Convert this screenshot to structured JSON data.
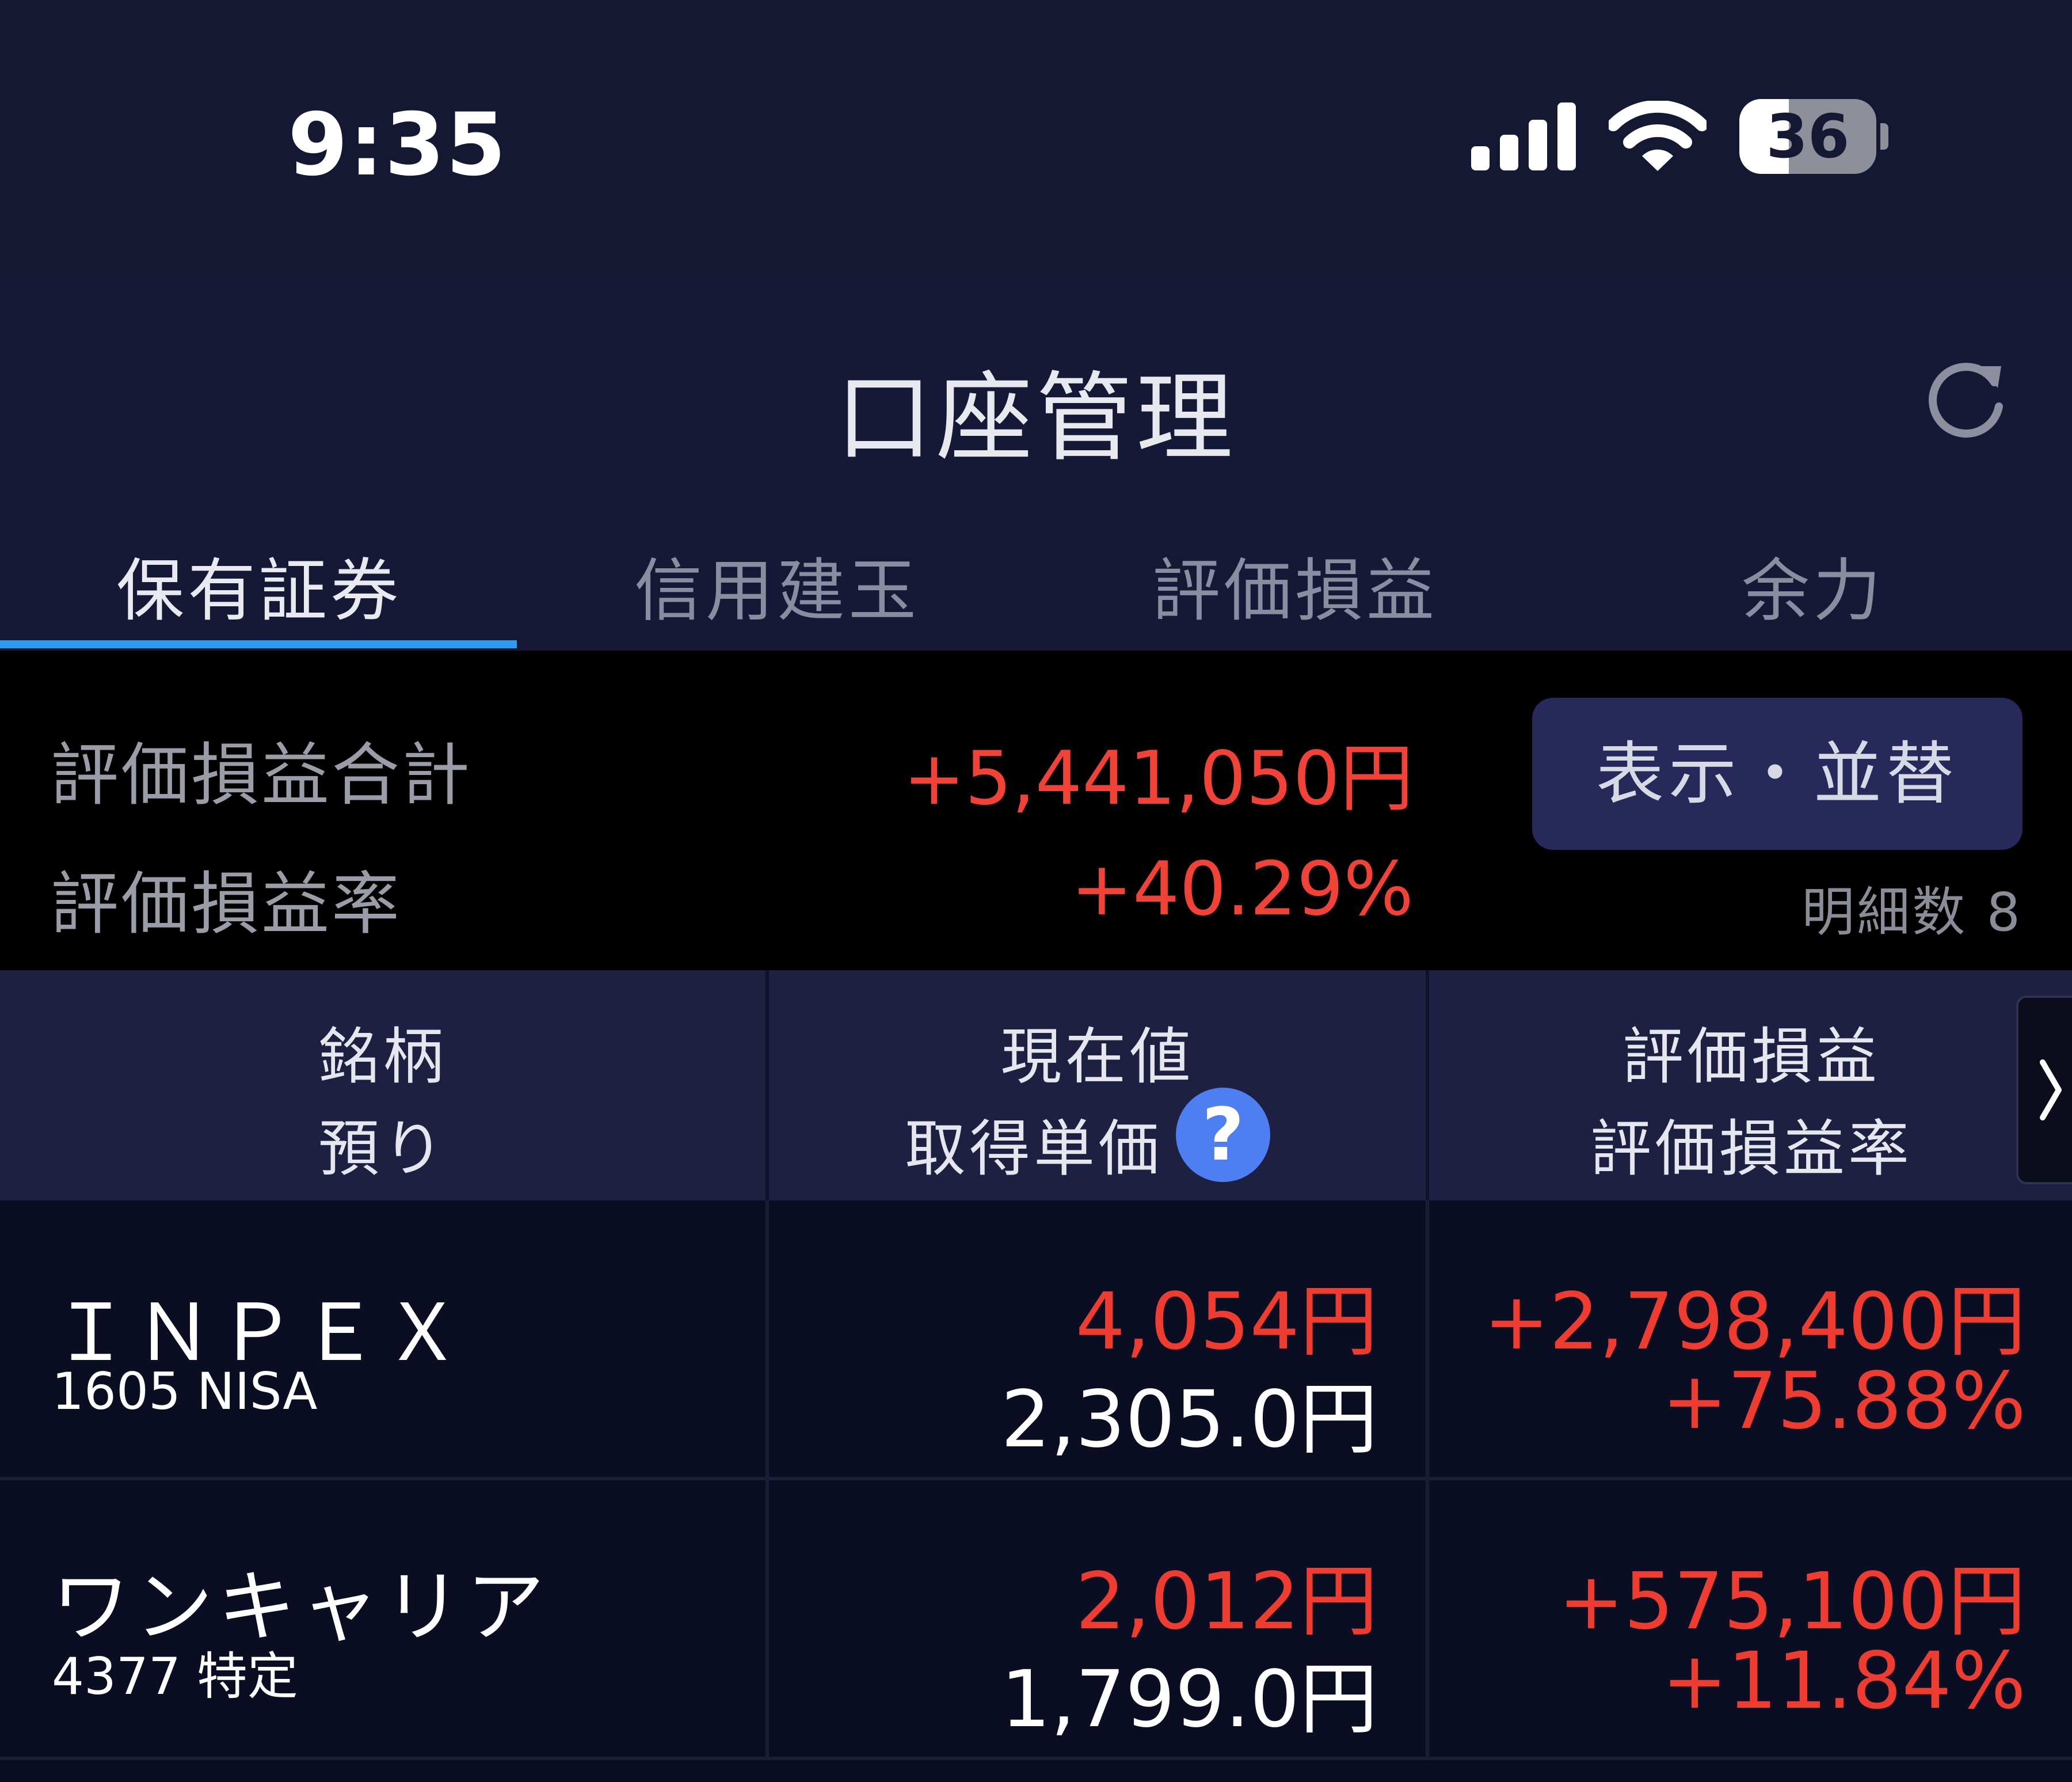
{
  "status_bar": {
    "time": "9:35",
    "battery_level": "36",
    "battery_percent": 36,
    "icons": [
      "cellular-signal-icon",
      "wifi-icon",
      "battery-icon"
    ]
  },
  "header": {
    "title": "口座管理",
    "refresh_icon": "refresh-icon"
  },
  "tabs": [
    {
      "label": "保有証券",
      "active": true
    },
    {
      "label": "信用建玉",
      "active": false
    },
    {
      "label": "評価損益",
      "active": false
    },
    {
      "label": "余力",
      "active": false
    }
  ],
  "summary": {
    "total_label": "評価損益合計",
    "total_value": "+5,441,050円",
    "rate_label": "評価損益率",
    "rate_value": "+40.29%",
    "display_sort_button": "表示・並替",
    "detail_count": "明細数 8"
  },
  "columns": {
    "col1_line1": "銘柄",
    "col1_line2": "預り",
    "col2_line1": "現在値",
    "col2_line2": "取得単価",
    "col2_help": "?",
    "col3_line1": "評価損益",
    "col3_line2": "評価損益率",
    "scroll_icon": "chevron-right-icon"
  },
  "holdings": [
    {
      "name": "ＩＮＰＥＸ",
      "code_account": "1605 NISA",
      "current_price": "4,054円",
      "acquisition_price": "2,305.0円",
      "pl": "+2,798,400円",
      "pl_rate": "+75.88%"
    },
    {
      "name": "ワンキャリア",
      "code_account": "4377 特定",
      "current_price": "2,012円",
      "acquisition_price": "1,799.0円",
      "pl": "+575,100円",
      "pl_rate": "+11.84%"
    }
  ],
  "colors": {
    "background": "#0b0e22",
    "header_bg": "#161936",
    "accent_tab": "#2c9cef",
    "positive": "#ee3c30",
    "button_bg": "#26295a",
    "help_icon": "#4d7ff0"
  }
}
